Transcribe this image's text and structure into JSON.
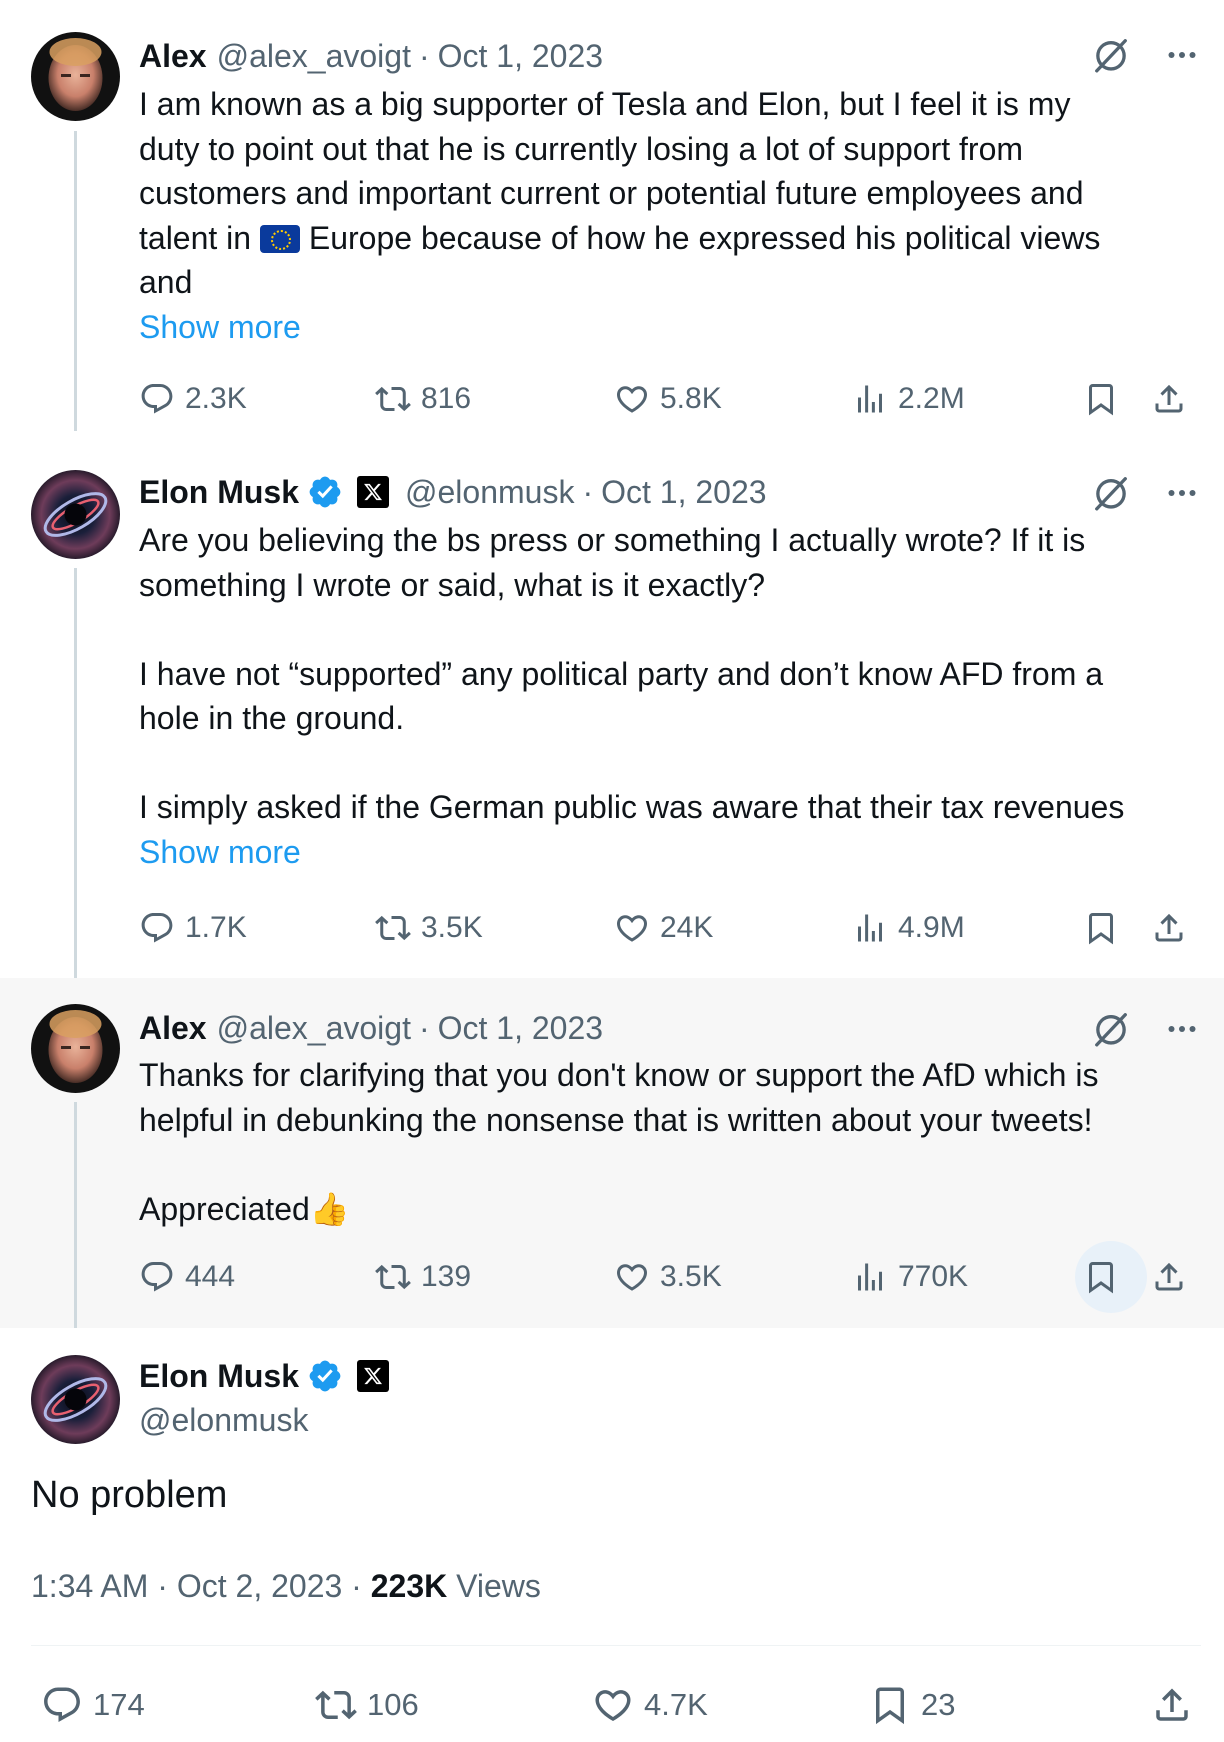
{
  "tweets": [
    {
      "name": "Alex",
      "handle": "@alex_avoigt",
      "date": "Oct 1, 2023",
      "text_lines": [
        "I am known as a big supporter of Tesla and Elon, but I feel it is my",
        "duty to point out that he is currently losing a lot of support from",
        "customers and important current or potential future employees and",
        "talent in",
        "Europe because of how he expressed his political views",
        "and"
      ],
      "show_more": "Show more",
      "replies": "2.3K",
      "reposts": "816",
      "likes": "5.8K",
      "views": "2.2M"
    },
    {
      "name": "Elon Musk",
      "handle": "@elonmusk",
      "date": "Oct 1, 2023",
      "text_lines": [
        "Are you believing the bs press or something I actually wrote? If it is",
        "something I wrote or said, what is it exactly?",
        "I have not “supported” any political party and don’t know AFD from a",
        "hole in the ground.",
        "I simply asked if the German public was aware that their tax revenues"
      ],
      "show_more": "Show more",
      "replies": "1.7K",
      "reposts": "3.5K",
      "likes": "24K",
      "views": "4.9M"
    },
    {
      "name": "Alex",
      "handle": "@alex_avoigt",
      "date": "Oct 1, 2023",
      "text_lines": [
        "Thanks for clarifying that you don't know or support the AfD which is",
        "helpful in debunking the nonsense that is written about your tweets!",
        "Appreciated"
      ],
      "emoji": "👍",
      "replies": "444",
      "reposts": "139",
      "likes": "3.5K",
      "views": "770K"
    }
  ],
  "main_tweet": {
    "name": "Elon Musk",
    "handle": "@elonmusk",
    "text": "No problem",
    "time": "1:34 AM",
    "date": "Oct 2, 2023",
    "views_count": "223K",
    "views_label": "Views",
    "replies": "174",
    "reposts": "106",
    "likes": "4.7K",
    "bookmarks": "23"
  },
  "colors": {
    "text": "#0f1419",
    "muted": "#536471",
    "link": "#1d9bf0",
    "verified": "#1d9bf0",
    "highlight_bg": "#f7f7f7"
  }
}
